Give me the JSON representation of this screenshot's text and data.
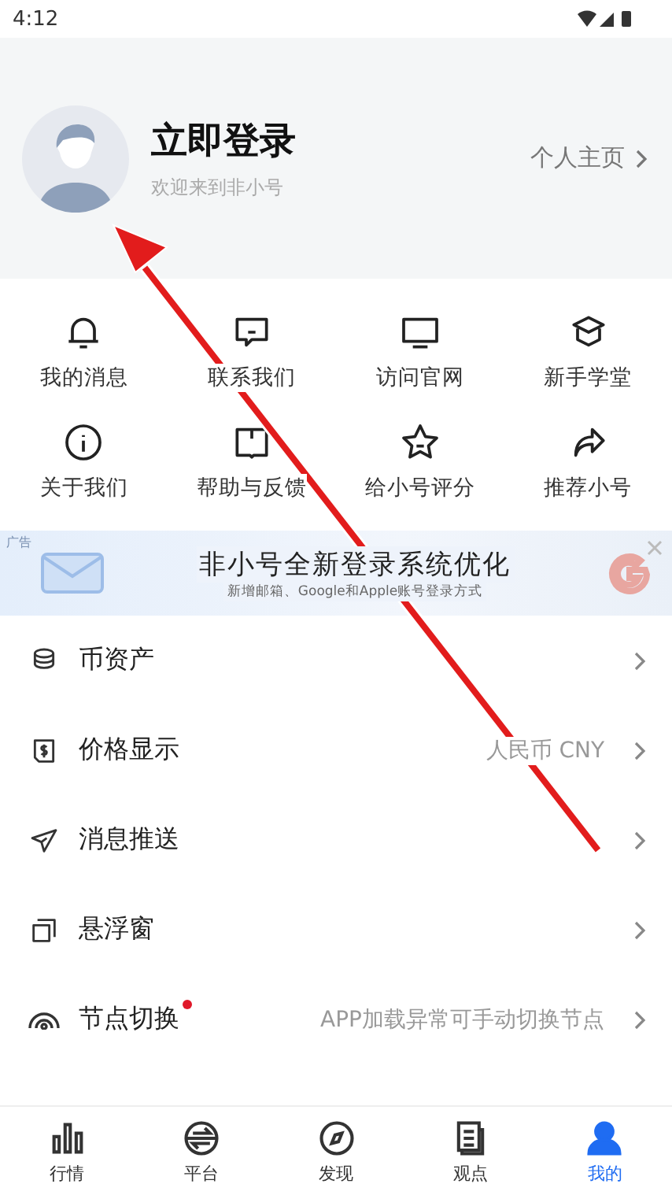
{
  "status_bar": {
    "time": "4:12"
  },
  "profile": {
    "title": "立即登录",
    "subtitle": "欢迎来到非小号",
    "link": "个人主页"
  },
  "shortcuts": [
    {
      "label": "我的消息"
    },
    {
      "label": "联系我们"
    },
    {
      "label": "访问官网"
    },
    {
      "label": "新手学堂"
    },
    {
      "label": "关于我们"
    },
    {
      "label": "帮助与反馈"
    },
    {
      "label": "给小号评分"
    },
    {
      "label": "推荐小号"
    }
  ],
  "ad": {
    "tag": "广告",
    "title": "非小号全新登录系统优化",
    "subtitle": "新增邮箱、Google和Apple账号登录方式"
  },
  "settings": [
    {
      "label": "币资产",
      "badge": false
    },
    {
      "label": "价格显示",
      "value": "人民币 CNY",
      "badge": false
    },
    {
      "label": "消息推送",
      "badge": false
    },
    {
      "label": "悬浮窗",
      "badge": false
    },
    {
      "label": "节点切换",
      "value": "APP加载异常可手动切换节点",
      "badge": true
    }
  ],
  "tabs": [
    {
      "label": "行情",
      "selected": false
    },
    {
      "label": "平台",
      "selected": false
    },
    {
      "label": "发现",
      "selected": false
    },
    {
      "label": "观点",
      "selected": false
    },
    {
      "label": "我的",
      "selected": true
    }
  ]
}
